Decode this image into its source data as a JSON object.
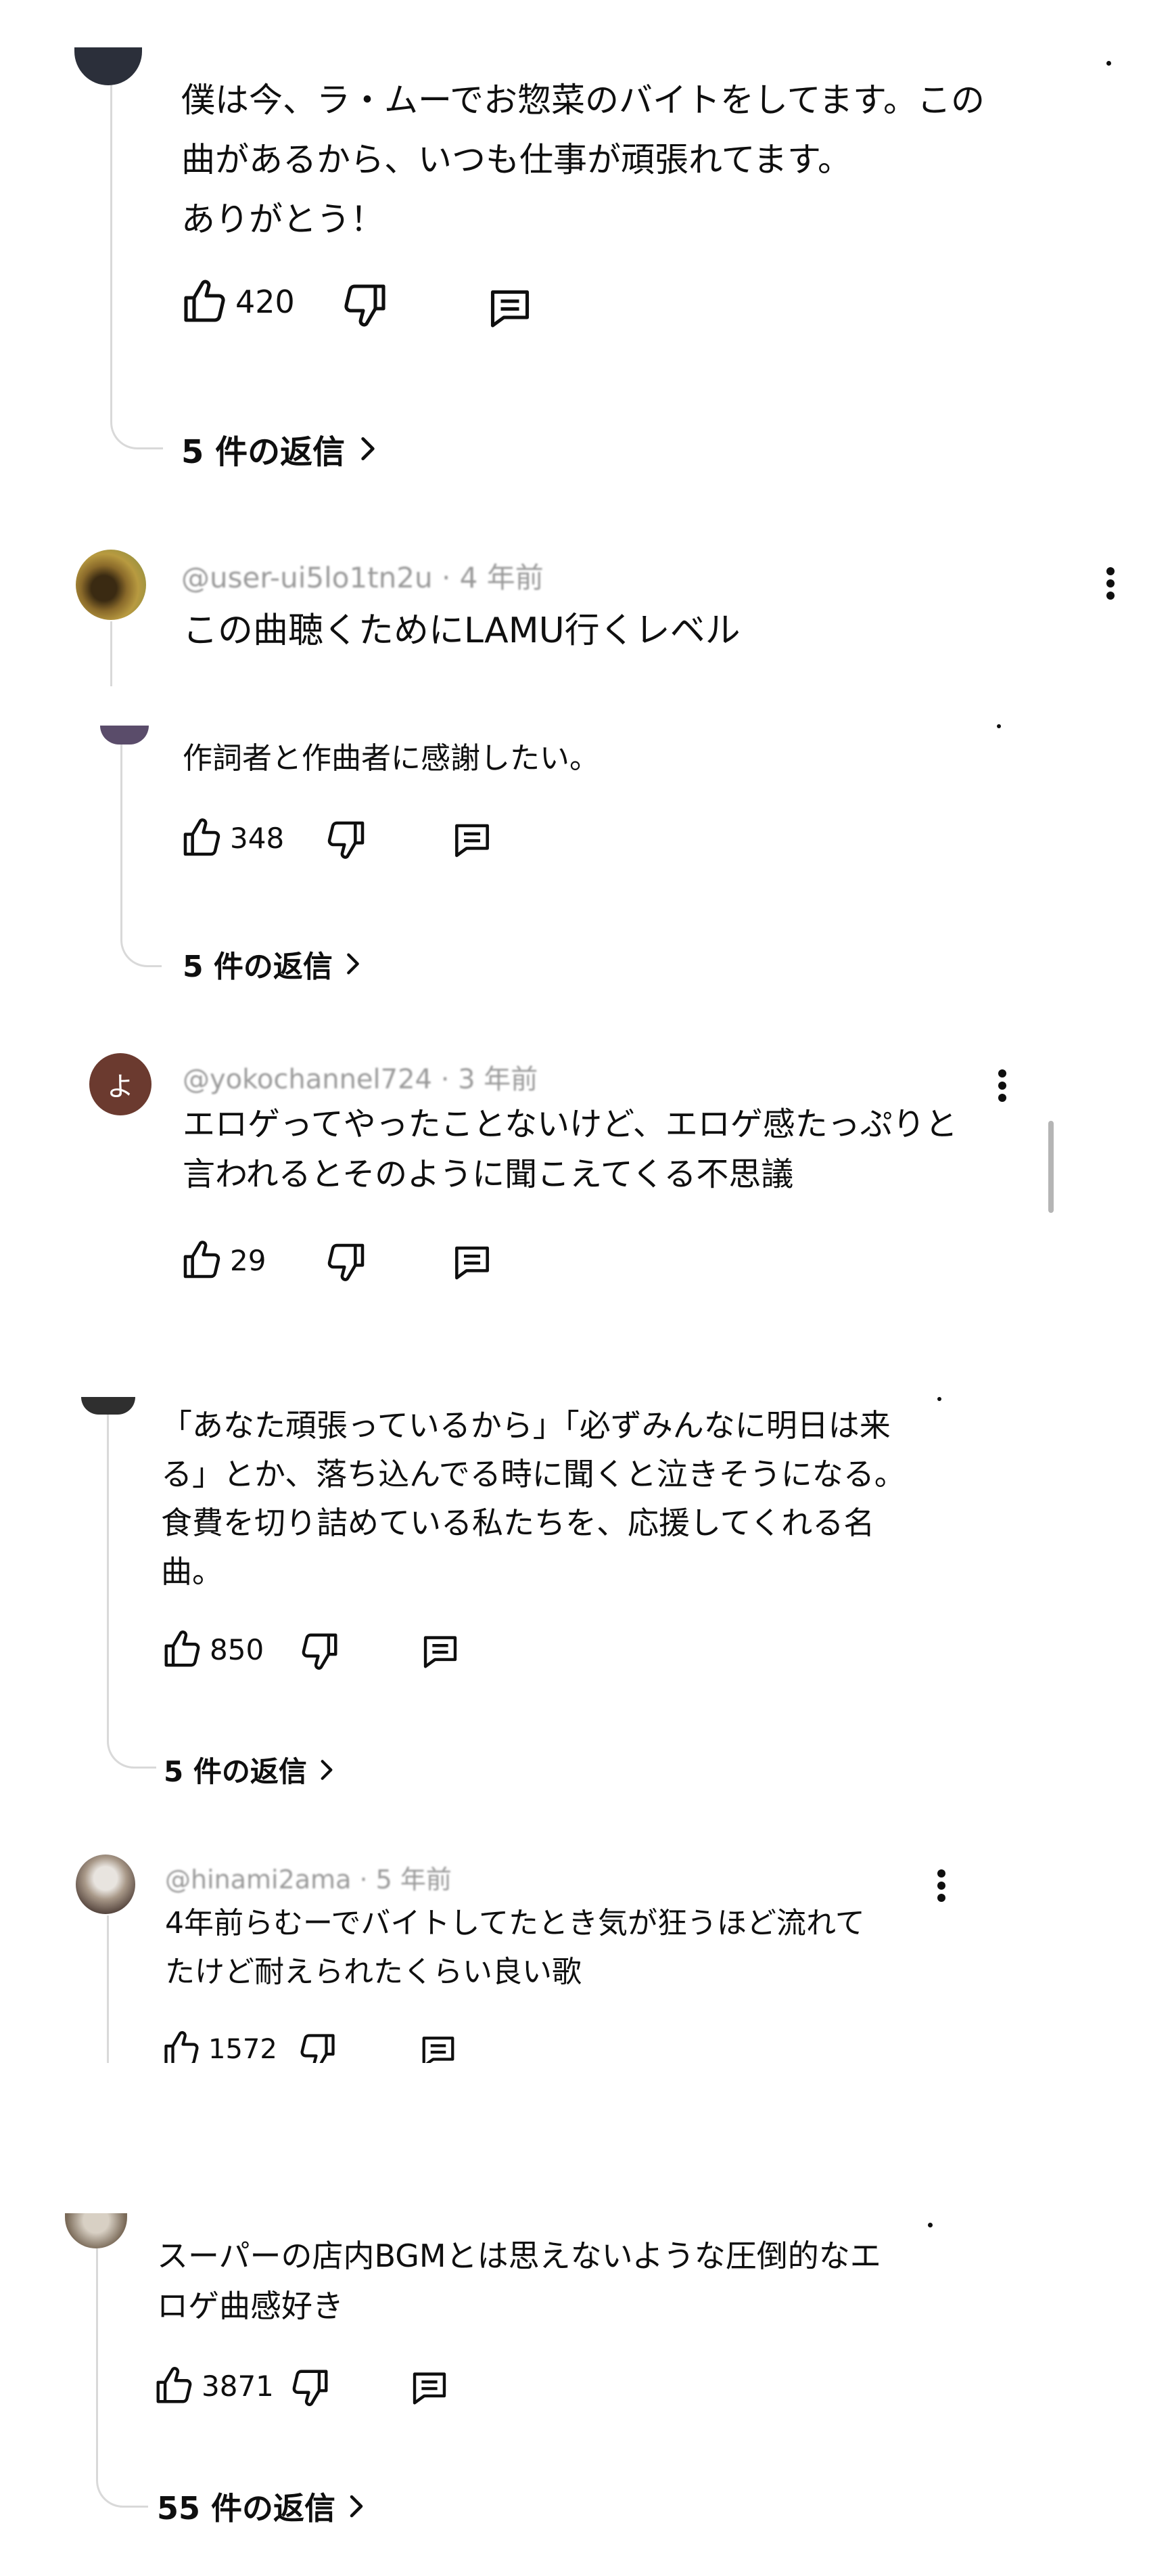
{
  "comments": [
    {
      "author": "",
      "time": "",
      "text": "僕は今、ラ・ムーでお惣菜のバイトをしてます。この\n曲があるから、いつも仕事が頑張れてます。\nありがとう！",
      "likes": "420",
      "replies": "5 件の返信"
    },
    {
      "author": "@user-ui5lo1tn2u",
      "time": "4 年前",
      "text": "この曲聴くためにLAMU行くレベル"
    },
    {
      "author": "",
      "time": "",
      "text": "作詞者と作曲者に感謝したい。",
      "likes": "348",
      "replies": "5 件の返信"
    },
    {
      "author": "@yokochannel724",
      "time": "3 年前",
      "avatar_letter": "よ",
      "text": "エロゲってやったことないけど、エロゲ感たっぷりと\n言われるとそのように聞こえてくる不思議",
      "likes": "29"
    },
    {
      "author": "",
      "time": "",
      "text": "「あなた頑張っているから」「必ずみんなに明日は来\nる」とか、落ち込んでる時に聞くと泣きそうになる。\n食費を切り詰めている私たちを、応援してくれる名\n曲。",
      "likes": "850",
      "replies": "5 件の返信"
    },
    {
      "author": "@hinami2ama",
      "time": "5 年前",
      "text": "4年前らむーでバイトしてたとき気が狂うほど流れて\nたけど耐えられたくらい良い歌",
      "likes": "1572"
    },
    {
      "author": "",
      "time": "",
      "text": "スーパーの店内BGMとは思えないような圧倒的なエ\nロゲ曲感好き",
      "likes": "3871",
      "replies": "55 件の返信"
    }
  ],
  "colors": {
    "text": "#0f0f0f",
    "meta": "#9a9a9a",
    "thread": "#d9d9d9",
    "avatar_yoko": "#6b3a2f"
  },
  "icons": [
    "like-icon",
    "dislike-icon",
    "reply-icon",
    "chevron-right-icon",
    "more-vert-icon"
  ]
}
